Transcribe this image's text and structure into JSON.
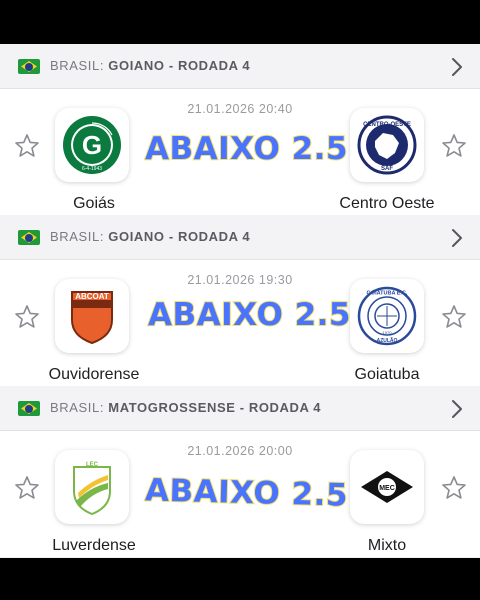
{
  "matches": [
    {
      "league": {
        "country": "BRASIL:",
        "name": "GOIANO - RODADA 4"
      },
      "datetime": "21.01.2026 20:40",
      "home": {
        "name": "Goiás",
        "logo_icon": "goias-crest-icon"
      },
      "away": {
        "name": "Centro Oeste",
        "logo_icon": "centro-oeste-crest-icon"
      },
      "overlay_text": "ABAIXO 2.5"
    },
    {
      "league": {
        "country": "BRASIL:",
        "name": "GOIANO - RODADA 4"
      },
      "datetime": "21.01.2026 19:30",
      "home": {
        "name": "Ouvidorense",
        "logo_icon": "ouvidorense-crest-icon"
      },
      "away": {
        "name": "Goiatuba",
        "logo_icon": "goiatuba-crest-icon"
      },
      "overlay_text": "ABAIXO 2.5"
    },
    {
      "league": {
        "country": "BRASIL:",
        "name": "MATOGROSSENSE - RODADA 4"
      },
      "datetime": "21.01.2026 20:00",
      "home": {
        "name": "Luverdense",
        "logo_icon": "luverdense-crest-icon"
      },
      "away": {
        "name": "Mixto",
        "logo_icon": "mixto-crest-icon"
      },
      "overlay_text": "ABAIXO 2.5"
    }
  ],
  "logo_lettering": {
    "goias": [
      "G",
      "GOIÁS ESPORTE CLUBE",
      "6-4-1943"
    ],
    "centro_oeste": [
      "CENTRO-OESTE",
      "SAF"
    ],
    "ouvidorense": [
      "ABCOAT"
    ],
    "goiatuba": [
      "GOIATUBA E.C.",
      "AZULÃO",
      "1970"
    ],
    "luverdense": [
      "LEC"
    ],
    "mixto": [
      "MEC"
    ]
  },
  "colors": {
    "overlay_fill": "#4a73ff",
    "overlay_outline": "#f0e06a",
    "brazil_green": "#1f9a3b",
    "brazil_yellow": "#f5d21f",
    "brazil_blue": "#1f3c8c"
  }
}
